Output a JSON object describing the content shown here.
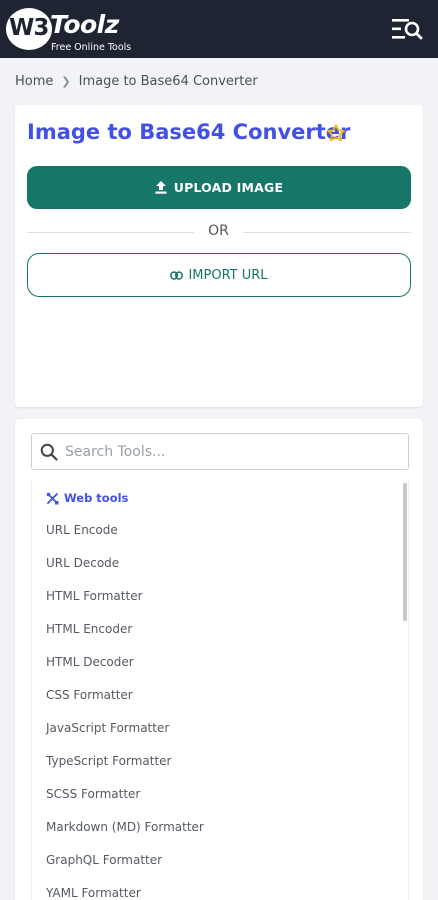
{
  "header": {
    "logo_mark": "W3",
    "logo_name": "Toolz",
    "logo_tagline": "Free Online Tools",
    "menu_icon": "menu-search-icon"
  },
  "breadcrumb": {
    "home": "Home",
    "current": "Image to Base64 Converter"
  },
  "converter": {
    "title": "Image to Base64 Converter",
    "star_icon": "star-outline-icon",
    "star_color": "#f2b600",
    "upload_label": "UPLOAD IMAGE",
    "or_label": "OR",
    "import_label": "IMPORT URL",
    "accent": "#167768",
    "title_color": "#4350e6"
  },
  "tools": {
    "search_placeholder": "Search Tools...",
    "category": "Web tools",
    "items": [
      "URL Encode",
      "URL Decode",
      "HTML Formatter",
      "HTML Encoder",
      "HTML Decoder",
      "CSS Formatter",
      "JavaScript Formatter",
      "TypeScript Formatter",
      "SCSS Formatter",
      "Markdown (MD) Formatter",
      "GraphQL Formatter",
      "YAML Formatter"
    ]
  }
}
